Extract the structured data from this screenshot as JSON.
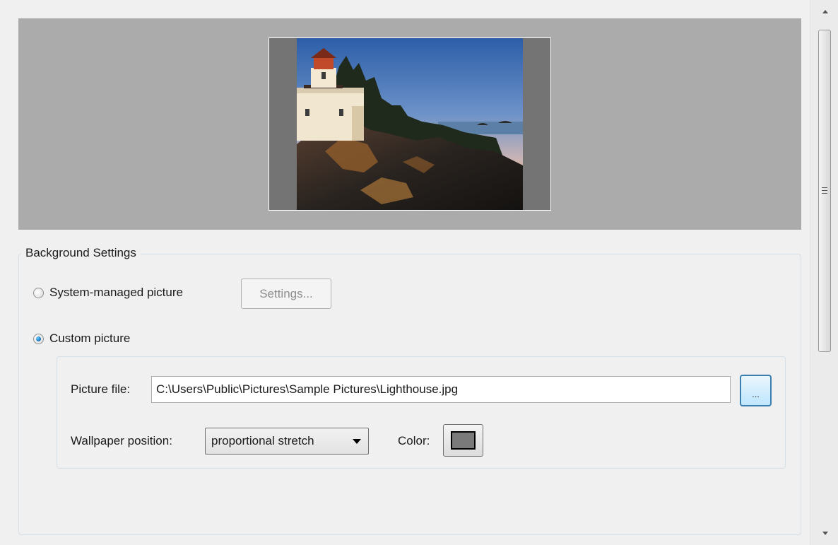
{
  "background_settings": {
    "legend": "Background Settings",
    "system_managed_label": "System-managed picture",
    "system_managed_checked": false,
    "settings_button_label": "Settings...",
    "custom_picture_label": "Custom picture",
    "custom_picture_checked": true,
    "picture_file_label": "Picture file:",
    "picture_file_value": "C:\\Users\\Public\\Pictures\\Sample Pictures\\Lighthouse.jpg",
    "browse_button_label": "...",
    "wallpaper_position_label": "Wallpaper position:",
    "wallpaper_position_value": "proportional stretch",
    "color_label": "Color:",
    "color_value": "#7a7a7a"
  },
  "preview": {
    "background_color": "#ababab",
    "monitor_fill_color": "#747474",
    "image_subject": "lighthouse"
  },
  "scrollbar": {
    "up_icon": "scroll-up-arrow-icon",
    "down_icon": "scroll-down-arrow-icon"
  }
}
